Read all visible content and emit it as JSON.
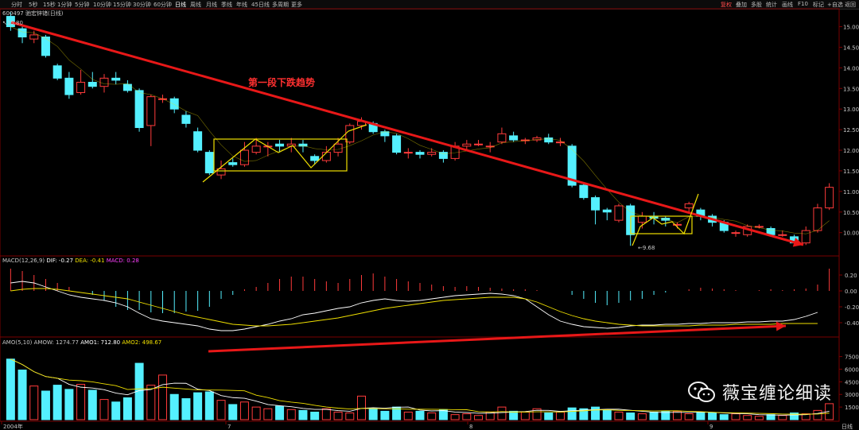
{
  "toolbar": {
    "left_items": [
      "分时",
      "5秒",
      "15秒",
      "1分钟",
      "5分钟",
      "10分钟",
      "15分钟",
      "30分钟",
      "60分钟",
      "日线",
      "周线",
      "月线",
      "季线",
      "年线",
      "45日线",
      "多周期",
      "更多"
    ],
    "active_index": 9,
    "right_items": [
      "复权",
      "叠加",
      "多股",
      "统计",
      "画线",
      "F10",
      "标记",
      "+自选",
      "返回"
    ]
  },
  "stock": {
    "code": "600497",
    "name": "驰宏锌锗",
    "period": "(日线)"
  },
  "price_axis": {
    "ticks": [
      "15.00",
      "14.50",
      "14.00",
      "13.50",
      "13.00",
      "12.50",
      "12.00",
      "11.50",
      "11.00",
      "10.50",
      "10.00"
    ],
    "min": 9.55,
    "max": 15.3
  },
  "annotations": {
    "high_label": "15.80",
    "low_label": "9.68",
    "trend_text": "第一段下跌趋势"
  },
  "macd": {
    "label": "MACD(12,26,9)",
    "dif": "DIF: -0.27",
    "dea": "DEA: -0.41",
    "macd": "MACD: 0.28",
    "ticks": [
      "0.20",
      "0.00",
      "-0.20",
      "-0.40"
    ]
  },
  "amo": {
    "label": "AMO(5,10)",
    "amow": "AMOW: 1274.77",
    "amo1": "AMO1: 712.80",
    "amo2": "AMO2: 498.67",
    "ticks": [
      "7500",
      "6000",
      "4500",
      "3000",
      "1500"
    ]
  },
  "date_axis": {
    "labels": [
      "2004年",
      "7",
      "8",
      "9"
    ],
    "right_label": "日线"
  },
  "watermark": {
    "text": "薇宝缠论细读"
  },
  "colors": {
    "up": "#ff3b3b",
    "down": "#54f0ff",
    "trend": "#e81818",
    "box": "#f0e000",
    "ma": "#ffffff",
    "ma2": "#f0e000",
    "macd_bar": "#ff3bff"
  },
  "chart_data": {
    "type": "candlestick",
    "candles": [
      {
        "o": 15.25,
        "c": 15.0,
        "h": 15.35,
        "l": 14.9
      },
      {
        "o": 14.95,
        "c": 14.75,
        "h": 15.0,
        "l": 14.6
      },
      {
        "o": 14.7,
        "c": 14.8,
        "h": 14.9,
        "l": 14.6
      },
      {
        "o": 14.75,
        "c": 14.3,
        "h": 14.8,
        "l": 14.25
      },
      {
        "o": 14.05,
        "c": 13.75,
        "h": 14.1,
        "l": 13.7
      },
      {
        "o": 13.75,
        "c": 13.35,
        "h": 13.9,
        "l": 13.25
      },
      {
        "o": 13.4,
        "c": 13.65,
        "h": 13.95,
        "l": 13.35
      },
      {
        "o": 13.65,
        "c": 13.55,
        "h": 13.9,
        "l": 13.5
      },
      {
        "o": 13.55,
        "c": 13.75,
        "h": 13.85,
        "l": 13.4
      },
      {
        "o": 13.75,
        "c": 13.7,
        "h": 13.9,
        "l": 13.6
      },
      {
        "o": 13.6,
        "c": 13.45,
        "h": 13.7,
        "l": 13.4
      },
      {
        "o": 13.45,
        "c": 12.55,
        "h": 13.5,
        "l": 12.45
      },
      {
        "o": 12.6,
        "c": 13.3,
        "h": 13.35,
        "l": 12.1
      },
      {
        "o": 13.25,
        "c": 13.25,
        "h": 13.35,
        "l": 13.15
      },
      {
        "o": 13.25,
        "c": 13.0,
        "h": 13.3,
        "l": 12.9
      },
      {
        "o": 12.85,
        "c": 12.65,
        "h": 12.95,
        "l": 12.55
      },
      {
        "o": 12.45,
        "c": 12.0,
        "h": 12.55,
        "l": 11.95
      },
      {
        "o": 11.95,
        "c": 11.45,
        "h": 12.0,
        "l": 11.4
      },
      {
        "o": 11.4,
        "c": 11.55,
        "h": 11.75,
        "l": 11.3
      },
      {
        "o": 11.7,
        "c": 11.65,
        "h": 11.8,
        "l": 11.6
      },
      {
        "o": 11.65,
        "c": 12.0,
        "h": 12.2,
        "l": 11.6
      },
      {
        "o": 11.95,
        "c": 12.1,
        "h": 12.3,
        "l": 11.9
      },
      {
        "o": 12.1,
        "c": 12.1,
        "h": 12.2,
        "l": 11.85
      },
      {
        "o": 12.15,
        "c": 12.1,
        "h": 12.25,
        "l": 11.95
      },
      {
        "o": 12.1,
        "c": 12.15,
        "h": 12.3,
        "l": 11.95
      },
      {
        "o": 12.15,
        "c": 12.1,
        "h": 12.25,
        "l": 11.95
      },
      {
        "o": 11.85,
        "c": 11.75,
        "h": 11.9,
        "l": 11.65
      },
      {
        "o": 11.75,
        "c": 11.95,
        "h": 12.1,
        "l": 11.7
      },
      {
        "o": 11.95,
        "c": 12.15,
        "h": 12.3,
        "l": 11.85
      },
      {
        "o": 12.2,
        "c": 12.6,
        "h": 12.65,
        "l": 12.15
      },
      {
        "o": 12.6,
        "c": 12.7,
        "h": 12.8,
        "l": 12.5
      },
      {
        "o": 12.65,
        "c": 12.45,
        "h": 12.7,
        "l": 12.4
      },
      {
        "o": 12.45,
        "c": 12.35,
        "h": 12.5,
        "l": 12.2
      },
      {
        "o": 12.35,
        "c": 11.95,
        "h": 12.4,
        "l": 11.9
      },
      {
        "o": 11.95,
        "c": 11.95,
        "h": 12.05,
        "l": 11.8
      },
      {
        "o": 11.95,
        "c": 11.9,
        "h": 12.0,
        "l": 11.8
      },
      {
        "o": 11.9,
        "c": 11.95,
        "h": 12.05,
        "l": 11.85
      },
      {
        "o": 11.95,
        "c": 11.8,
        "h": 12.0,
        "l": 11.7
      },
      {
        "o": 11.8,
        "c": 12.1,
        "h": 12.2,
        "l": 11.75
      },
      {
        "o": 12.1,
        "c": 12.15,
        "h": 12.25,
        "l": 12.0
      },
      {
        "o": 12.15,
        "c": 12.15,
        "h": 12.25,
        "l": 12.1
      },
      {
        "o": 12.1,
        "c": 12.1,
        "h": 12.2,
        "l": 11.95
      },
      {
        "o": 12.2,
        "c": 12.4,
        "h": 12.55,
        "l": 12.15
      },
      {
        "o": 12.35,
        "c": 12.25,
        "h": 12.45,
        "l": 12.2
      },
      {
        "o": 12.25,
        "c": 12.25,
        "h": 12.3,
        "l": 12.15
      },
      {
        "o": 12.25,
        "c": 12.3,
        "h": 12.35,
        "l": 12.2
      },
      {
        "o": 12.3,
        "c": 12.2,
        "h": 12.4,
        "l": 12.15
      },
      {
        "o": 12.2,
        "c": 12.2,
        "h": 12.3,
        "l": 12.1
      },
      {
        "o": 12.1,
        "c": 11.15,
        "h": 12.15,
        "l": 11.1
      },
      {
        "o": 11.15,
        "c": 10.85,
        "h": 11.2,
        "l": 10.8
      },
      {
        "o": 10.85,
        "c": 10.55,
        "h": 10.9,
        "l": 10.2
      },
      {
        "o": 10.55,
        "c": 10.5,
        "h": 10.6,
        "l": 10.3
      },
      {
        "o": 10.3,
        "c": 10.65,
        "h": 10.7,
        "l": 10.25
      },
      {
        "o": 10.65,
        "c": 9.95,
        "h": 10.7,
        "l": 9.68
      },
      {
        "o": 10.25,
        "c": 10.4,
        "h": 10.5,
        "l": 10.1
      },
      {
        "o": 10.4,
        "c": 10.35,
        "h": 10.5,
        "l": 10.2
      },
      {
        "o": 10.35,
        "c": 10.3,
        "h": 10.4,
        "l": 10.15
      },
      {
        "o": 10.2,
        "c": 10.2,
        "h": 10.25,
        "l": 10.1
      },
      {
        "o": 10.6,
        "c": 10.7,
        "h": 10.75,
        "l": 10.5
      },
      {
        "o": 10.55,
        "c": 10.4,
        "h": 10.6,
        "l": 10.3
      },
      {
        "o": 10.4,
        "c": 10.25,
        "h": 10.45,
        "l": 10.15
      },
      {
        "o": 10.25,
        "c": 10.05,
        "h": 10.3,
        "l": 10.0
      },
      {
        "o": 10.0,
        "c": 10.0,
        "h": 10.05,
        "l": 9.9
      },
      {
        "o": 9.95,
        "c": 10.15,
        "h": 10.2,
        "l": 9.9
      },
      {
        "o": 10.15,
        "c": 10.15,
        "h": 10.2,
        "l": 10.1
      },
      {
        "o": 10.1,
        "c": 9.95,
        "h": 10.15,
        "l": 9.9
      },
      {
        "o": 9.95,
        "c": 9.95,
        "h": 10.05,
        "l": 9.9
      },
      {
        "o": 9.9,
        "c": 9.75,
        "h": 9.95,
        "l": 9.7
      },
      {
        "o": 9.75,
        "c": 10.05,
        "h": 10.15,
        "l": 9.7
      },
      {
        "o": 10.05,
        "c": 10.6,
        "h": 10.7,
        "l": 10.0
      },
      {
        "o": 10.6,
        "c": 11.1,
        "h": 11.2,
        "l": 10.55
      }
    ],
    "macd_hist": [
      0.28,
      0.25,
      0.2,
      0.15,
      0.1,
      0.05,
      0.0,
      -0.05,
      -0.12,
      -0.2,
      -0.24,
      -0.24,
      -0.27,
      -0.28,
      -0.28,
      -0.26,
      -0.25,
      -0.2,
      -0.1,
      -0.05,
      0.02,
      0.05,
      0.1,
      0.15,
      0.18,
      0.18,
      0.15,
      0.12,
      0.1,
      0.15,
      0.2,
      0.22,
      0.18,
      0.15,
      0.12,
      0.1,
      0.08,
      0.06,
      0.05,
      0.06,
      0.05,
      0.04,
      0.03,
      0.02,
      0.02,
      0.01,
      0.0,
      0.0,
      -0.05,
      -0.1,
      -0.15,
      -0.18,
      -0.15,
      -0.12,
      -0.1,
      -0.05,
      -0.02,
      0.0,
      0.02,
      0.04,
      0.03,
      0.02,
      0.01,
      0.0,
      0.01,
      0.02,
      0.01,
      0.02,
      0.03,
      0.08,
      0.28
    ],
    "amo_values": [
      7200,
      5900,
      4000,
      3400,
      4100,
      3600,
      4200,
      3500,
      2400,
      2100,
      2600,
      6700,
      4100,
      5300,
      3000,
      2500,
      3200,
      3300,
      2300,
      1800,
      2100,
      1500,
      1300,
      1600,
      1200,
      1100,
      900,
      1300,
      900,
      800,
      2800,
      1300,
      1000,
      1500,
      900,
      1000,
      800,
      1200,
      600,
      700,
      500,
      900,
      1500,
      1000,
      900,
      1300,
      800,
      900,
      1400,
      1300,
      1500,
      1100,
      900,
      800,
      700,
      900,
      1000,
      1000,
      700,
      900,
      800,
      600,
      700,
      500,
      400,
      600,
      500,
      800,
      700,
      1100,
      1900
    ],
    "dif_line": [
      0.1,
      0.12,
      0.1,
      0.05,
      0.0,
      -0.05,
      -0.08,
      -0.1,
      -0.12,
      -0.15,
      -0.2,
      -0.28,
      -0.35,
      -0.38,
      -0.4,
      -0.42,
      -0.44,
      -0.48,
      -0.5,
      -0.5,
      -0.48,
      -0.45,
      -0.42,
      -0.38,
      -0.35,
      -0.3,
      -0.28,
      -0.25,
      -0.22,
      -0.2,
      -0.15,
      -0.12,
      -0.1,
      -0.12,
      -0.13,
      -0.12,
      -0.1,
      -0.08,
      -0.06,
      -0.05,
      -0.04,
      -0.03,
      -0.04,
      -0.06,
      -0.1,
      -0.2,
      -0.3,
      -0.38,
      -0.42,
      -0.45,
      -0.46,
      -0.47,
      -0.46,
      -0.44,
      -0.43,
      -0.43,
      -0.42,
      -0.42,
      -0.41,
      -0.41,
      -0.4,
      -0.4,
      -0.4,
      -0.39,
      -0.39,
      -0.38,
      -0.38,
      -0.36,
      -0.32,
      -0.27
    ],
    "dea_line": [
      0.0,
      0.02,
      0.03,
      0.03,
      0.02,
      0.0,
      -0.02,
      -0.04,
      -0.06,
      -0.08,
      -0.1,
      -0.14,
      -0.18,
      -0.22,
      -0.26,
      -0.3,
      -0.33,
      -0.36,
      -0.39,
      -0.42,
      -0.43,
      -0.44,
      -0.44,
      -0.43,
      -0.42,
      -0.4,
      -0.38,
      -0.36,
      -0.34,
      -0.31,
      -0.28,
      -0.25,
      -0.22,
      -0.2,
      -0.18,
      -0.16,
      -0.14,
      -0.12,
      -0.11,
      -0.1,
      -0.09,
      -0.08,
      -0.08,
      -0.08,
      -0.1,
      -0.14,
      -0.2,
      -0.26,
      -0.31,
      -0.35,
      -0.38,
      -0.4,
      -0.42,
      -0.43,
      -0.44,
      -0.44,
      -0.44,
      -0.44,
      -0.44,
      -0.43,
      -0.43,
      -0.43,
      -0.42,
      -0.42,
      -0.42,
      -0.42,
      -0.41,
      -0.41,
      -0.41,
      -0.41
    ]
  }
}
